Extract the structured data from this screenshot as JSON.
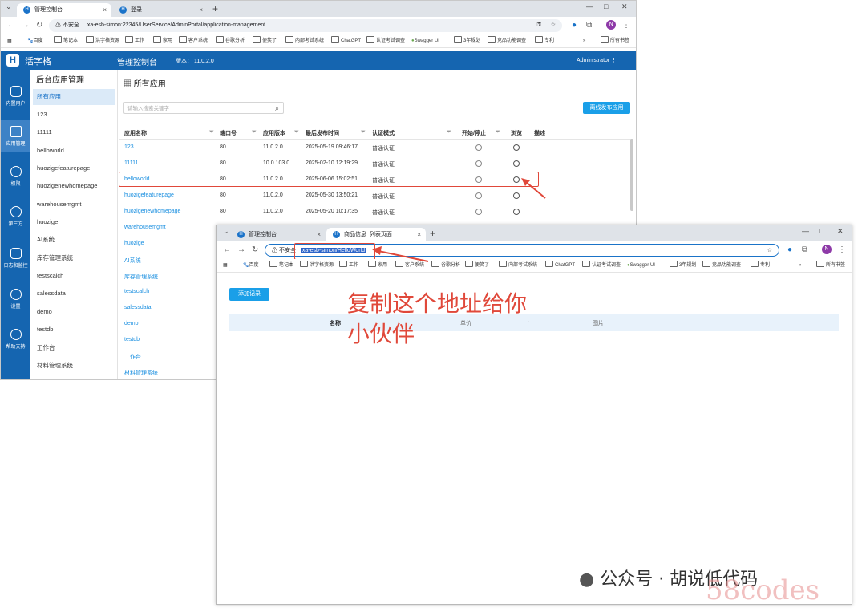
{
  "browserA": {
    "tabs": [
      {
        "label": "管理控制台"
      },
      {
        "label": "登录"
      }
    ],
    "address": {
      "not_secure": "不安全",
      "url": "xa-esb-simon:22345/UserService/AdminPortal/application-management"
    },
    "profile_initial": "N",
    "bookmarks": [
      "百度",
      "笔记本",
      "洪字格资源",
      "工作",
      "家用",
      "客户系统",
      "谷歌分析",
      "便笑了",
      "内部考试系统",
      "ChatGPT",
      "认证考试调查",
      "Swagger UI",
      "3年规划",
      "竞品功能调查",
      "专利"
    ],
    "all_bookmarks": "所有书签"
  },
  "app": {
    "logo_letter": "H",
    "brand": "活字格",
    "title": "管理控制台",
    "version": "版本： 11.0.2.0",
    "user": "Administrator"
  },
  "iconbar": [
    {
      "label": "内置用户",
      "icon": "user-icon"
    },
    {
      "label": "应用管理",
      "icon": "apps-icon"
    },
    {
      "label": "权限",
      "icon": "permission-icon"
    },
    {
      "label": "第三方",
      "icon": "third-party-icon"
    },
    {
      "label": "日志和监控",
      "icon": "log-icon"
    },
    {
      "label": "设置",
      "icon": "gear-icon"
    },
    {
      "label": "帮助支持",
      "icon": "help-icon"
    }
  ],
  "menu": {
    "title": "后台应用管理",
    "items": [
      "所有应用",
      "123",
      "11111",
      "helloworld",
      "huozigefeaturepage",
      "huozigenewhomepage",
      "warehousemgmt",
      "huozige",
      "AI系统",
      "库存管理系统",
      "testscalch",
      "salessdata",
      "demo",
      "testdb",
      "工作台",
      "材料管理系统"
    ]
  },
  "content": {
    "title": "所有应用",
    "search_placeholder": "请输入搜索关键字",
    "publish_button": "离线发布应用",
    "headers": {
      "name": "应用名称",
      "port": "端口号",
      "version": "应用版本",
      "last_publish": "最后发布时间",
      "auth": "认证模式",
      "start_stop": "开始/停止",
      "browse": "浏览",
      "desc": "描述"
    },
    "rows": [
      {
        "name": "123",
        "port": "80",
        "version": "11.0.2.0",
        "time": "2025-05-19 09:46:17",
        "auth": "普通认证"
      },
      {
        "name": "11111",
        "port": "80",
        "version": "10.0.103.0",
        "time": "2025-02-10 12:19:29",
        "auth": "普通认证"
      },
      {
        "name": "helloworld",
        "port": "80",
        "version": "11.0.2.0",
        "time": "2025-06-06 15:02:51",
        "auth": "普通认证"
      },
      {
        "name": "huozigefeaturepage",
        "port": "80",
        "version": "11.0.2.0",
        "time": "2025-05-30 13:50:21",
        "auth": "普通认证"
      },
      {
        "name": "huozigenewhomepage",
        "port": "80",
        "version": "11.0.2.0",
        "time": "2025-05-20 10:17:35",
        "auth": "普通认证"
      }
    ],
    "more_names": [
      "warehousemgmt",
      "huozige",
      "AI系统",
      "库存管理系统",
      "testscalch",
      "salessdata",
      "demo",
      "testdb",
      "工作台",
      "材料管理系统"
    ]
  },
  "browserB": {
    "tabs": [
      {
        "label": "管理控制台"
      },
      {
        "label": "商品信息_列表页面"
      }
    ],
    "address": {
      "not_secure": "不安全",
      "url": "xa-esb-simon/HelloWorld"
    },
    "profile_initial": "N",
    "add_button": "添加记录",
    "headers": [
      "名称",
      "单价",
      "图片"
    ]
  },
  "annotation": {
    "line1": "复制这个地址给你",
    "line2": "小伙伴",
    "color": "#e0483a"
  },
  "watermark": {
    "wechat": "公众号 · 胡说低代码",
    "site": "58codes"
  }
}
